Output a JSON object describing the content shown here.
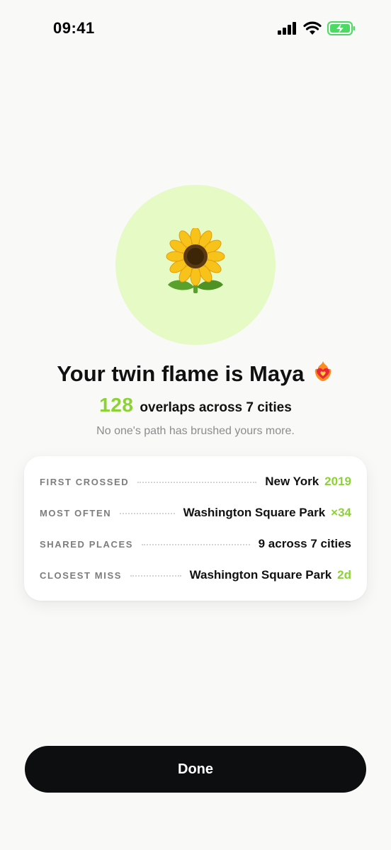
{
  "status_bar": {
    "time": "09:41",
    "icons": [
      "cellular-signal-icon",
      "wifi-icon",
      "battery-charging-icon"
    ],
    "battery_color": "#4cd964"
  },
  "hero": {
    "icon": "sunflower-icon",
    "circle_color": "#e6fac6"
  },
  "headline": {
    "text": "Your twin flame is Maya",
    "emoji": "heart-on-fire-icon"
  },
  "overlap": {
    "count": "128",
    "text": "overlaps across 7 cities"
  },
  "subtext": "No one's path has brushed yours more.",
  "accent_color": "#8cd234",
  "stats": [
    {
      "label": "FIRST CROSSED",
      "value": "New York",
      "accent": "2019"
    },
    {
      "label": "MOST OFTEN",
      "value": "Washington Square Park",
      "accent": "×34"
    },
    {
      "label": "SHARED PLACES",
      "value": "9 across 7 cities",
      "accent": ""
    },
    {
      "label": "CLOSEST MISS",
      "value": "Washington Square Park",
      "accent": "2d"
    }
  ],
  "done_label": "Done"
}
